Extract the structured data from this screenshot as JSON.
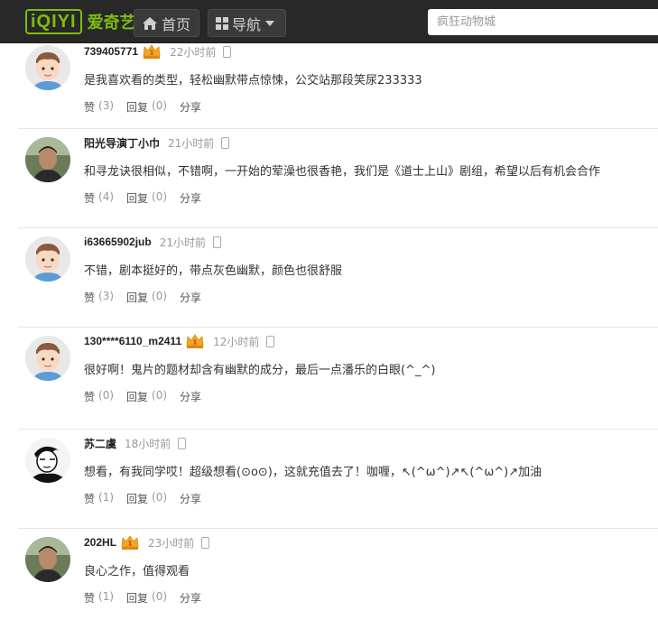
{
  "header": {
    "logo_mark": "iQIYI",
    "logo_text": "爱奇艺",
    "home_label": "首页",
    "nav_label": "导航",
    "search_placeholder": "疯狂动物城"
  },
  "comments": [
    {
      "username": "739405771",
      "time": "22小时前",
      "text": "是我喜欢看的类型，轻松幽默带点惊悚，公交站那段笑尿233333",
      "like_label": "赞",
      "like_count": "(3)",
      "reply_label": "回复",
      "reply_count": "(0)",
      "share_label": "分享",
      "vip": true,
      "avatar": "default-avatar-icon"
    },
    {
      "username": "阳光导演丁小巾",
      "time": "21小时前",
      "text": "和寻龙诀很相似，不错啊，一开始的荤澡也很香艳，我们是《道士上山》剧组，希望以后有机会合作",
      "like_label": "赞",
      "like_count": "(4)",
      "reply_label": "回复",
      "reply_count": "(0)",
      "share_label": "分享",
      "vip": false,
      "avatar": "photo-avatar-icon"
    },
    {
      "username": "i63665902jub",
      "time": "21小时前",
      "text": "不错，剧本挺好的，带点灰色幽默，颜色也很舒服",
      "like_label": "赞",
      "like_count": "(3)",
      "reply_label": "回复",
      "reply_count": "(0)",
      "share_label": "分享",
      "vip": false,
      "avatar": "default-avatar-icon"
    },
    {
      "username": "130****6110_m2411",
      "time": "12小时前",
      "text": "很好啊！鬼片的题材却含有幽默的成分，最后一点潘乐的白眼(^_^)",
      "like_label": "赞",
      "like_count": "(0)",
      "reply_label": "回复",
      "reply_count": "(0)",
      "share_label": "分享",
      "vip": true,
      "avatar": "default-avatar-icon"
    },
    {
      "username": "苏二虞",
      "time": "18小时前",
      "text": "想看，有我同学哎！超级想看(⊙o⊙)，这就充值去了！咖喱，↖(^ω^)↗↖(^ω^)↗加油",
      "like_label": "赞",
      "like_count": "(1)",
      "reply_label": "回复",
      "reply_count": "(0)",
      "share_label": "分享",
      "vip": false,
      "avatar": "sketch-avatar-icon"
    },
    {
      "username": "202HL",
      "time": "23小时前",
      "text": "良心之作，值得观看",
      "like_label": "赞",
      "like_count": "(1)",
      "reply_label": "回复",
      "reply_count": "(0)",
      "share_label": "分享",
      "vip": true,
      "avatar": "photo-avatar-icon"
    }
  ],
  "colors": {
    "brand": "#7dbd0e",
    "topbar": "#282828",
    "vip_gold": "#f5a623"
  }
}
